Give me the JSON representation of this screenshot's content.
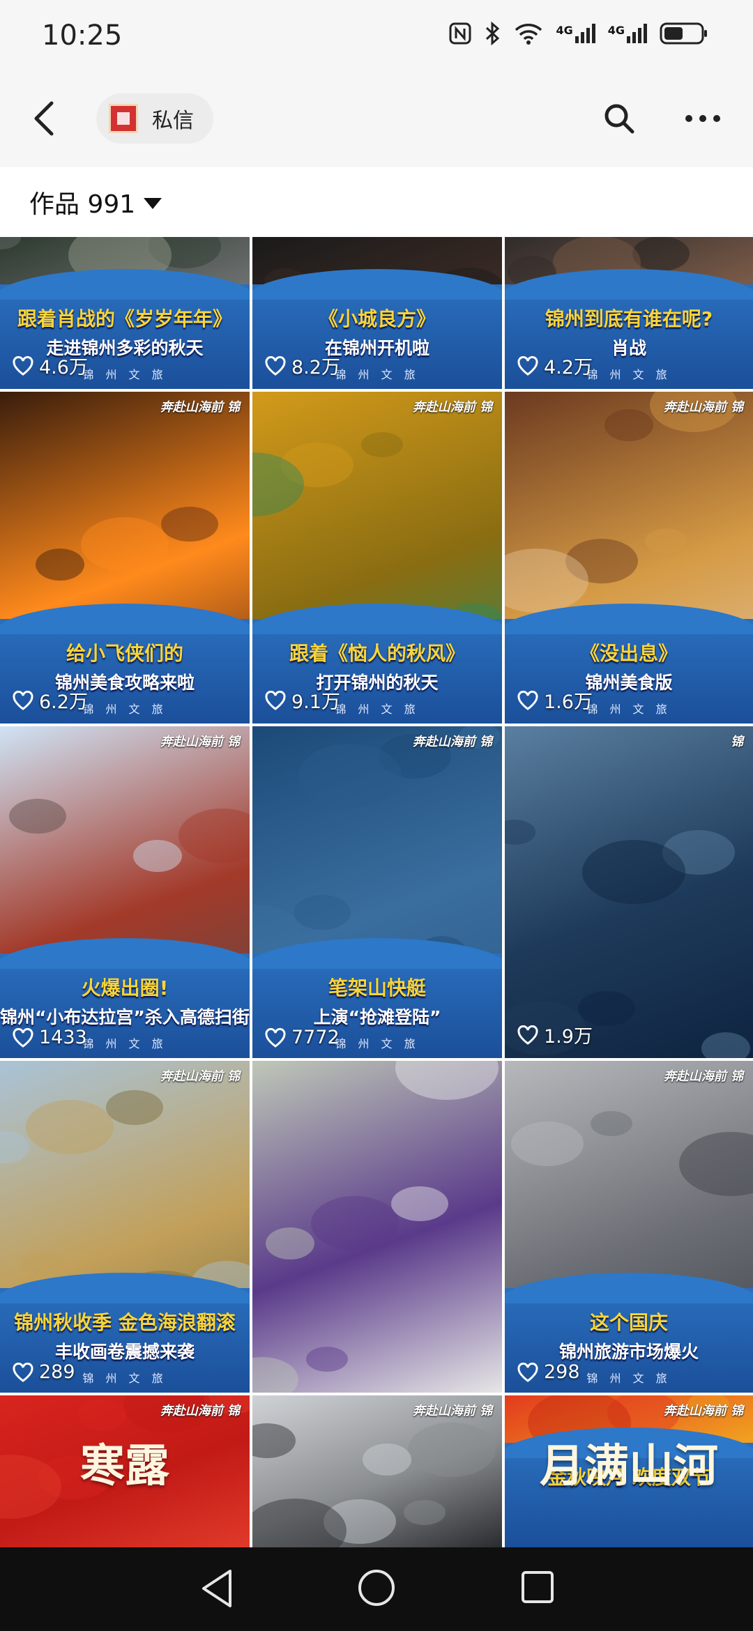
{
  "status_bar": {
    "time": "10:25",
    "signal_1": "4G",
    "signal_2": "4G"
  },
  "header": {
    "dm_label": "私信",
    "works_label": "作品 991"
  },
  "tiles": [
    {
      "cap1": "跟着肖战的《岁岁年年》",
      "cap2": "走进锦州多彩的秋天",
      "likes": "4.6万",
      "brand": "锦 州 文 旅",
      "topbrand": ""
    },
    {
      "cap1": "《小城良方》",
      "cap2": "在锦州开机啦",
      "likes": "8.2万",
      "brand": "锦 州 文 旅",
      "topbrand": ""
    },
    {
      "cap1": "锦州到底有谁在呢?",
      "cap2": "肖战",
      "likes": "4.2万",
      "brand": "锦 州 文 旅",
      "topbrand": ""
    },
    {
      "cap1": "给小飞侠们的",
      "cap2": "锦州美食攻略来啦",
      "likes": "6.2万",
      "brand": "锦 州 文 旅",
      "topbrand": "奔赴山海前 锦"
    },
    {
      "cap1": "跟着《恼人的秋风》",
      "cap2": "打开锦州的秋天",
      "likes": "9.1万",
      "brand": "锦 州 文 旅",
      "topbrand": "奔赴山海前 锦"
    },
    {
      "cap1": "《没出息》",
      "cap2": "锦州美食版",
      "likes": "1.6万",
      "brand": "锦 州 文 旅",
      "topbrand": "奔赴山海前 锦"
    },
    {
      "cap1": "火爆出圈!",
      "cap2": "锦州“小布达拉宫”杀入高德扫街榜",
      "likes": "1433",
      "brand": "锦 州 文 旅",
      "topbrand": "奔赴山海前 锦"
    },
    {
      "cap1": "笔架山快艇",
      "cap2": "上演“抢滩登陆”",
      "likes": "7772",
      "brand": "锦 州 文 旅",
      "topbrand": "奔赴山海前 锦"
    },
    {
      "cap1": "",
      "cap2": "",
      "likes": "1.9万",
      "brand": "",
      "topbrand": "锦"
    },
    {
      "cap1": "锦州秋收季 金色海浪翻滚",
      "cap2": "丰收画卷震撼来袭",
      "likes": "289",
      "brand": "锦 州 文 旅",
      "topbrand": "奔赴山海前 锦"
    },
    {
      "cap1": "",
      "cap2": "",
      "likes": "",
      "brand": "",
      "topbrand": ""
    },
    {
      "cap1": "这个国庆",
      "cap2": "锦州旅游市场爆火",
      "likes": "298",
      "brand": "锦 州 文 旅",
      "topbrand": "奔赴山海前 锦"
    },
    {
      "cap1": "",
      "cap2": "寒露",
      "likes": "",
      "brand": "",
      "topbrand": "奔赴山海前 锦"
    },
    {
      "cap1": "",
      "cap2": "",
      "likes": "",
      "brand": "",
      "topbrand": "奔赴山海前 锦"
    },
    {
      "cap1": "金秋映月 欢度双节",
      "cap2": "月满山河",
      "likes": "",
      "brand": "",
      "topbrand": "奔赴山海前 锦"
    }
  ],
  "colors": {
    "accent_wave": "#2a6fbd",
    "caption_yellow": "#f7d53a",
    "nav_bg": "#0f0f0f"
  }
}
